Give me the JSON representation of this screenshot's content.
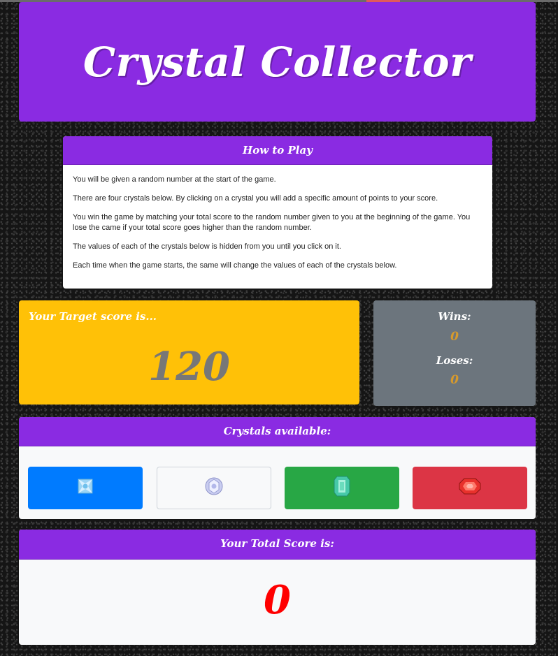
{
  "header": {
    "title": "Crystal Collector"
  },
  "how_to_play": {
    "title": "How to Play",
    "paragraphs": [
      "You will be given a random number at the start of the game.",
      "There are four crystals below. By clicking on a crystal you will add a specific amount of points to your score.",
      "You win the game by matching your total score to the random number given to you at the beginning of the game. You lose the came if your total score goes higher than the random number.",
      "The values of each of the crystals below is hidden from you until you click on it.",
      "Each time when the game starts, the same will change the values of each of the crystals below."
    ]
  },
  "target": {
    "label": "Your Target score is...",
    "value": "120"
  },
  "stats": {
    "wins_label": "Wins:",
    "wins_value": "0",
    "loses_label": "Loses:",
    "loses_value": "0"
  },
  "crystals": {
    "title": "Crystals available:",
    "items": [
      {
        "name": "blue-crystal-icon",
        "button_color": "#007bff"
      },
      {
        "name": "white-crystal-icon",
        "button_color": "#f8f9fa"
      },
      {
        "name": "green-crystal-icon",
        "button_color": "#28a745"
      },
      {
        "name": "red-crystal-icon",
        "button_color": "#dc3545"
      }
    ]
  },
  "total": {
    "label": "Your Total Score is:",
    "value": "0"
  },
  "colors": {
    "brand_purple": "#8a2be2",
    "target_yellow": "#ffc107",
    "stats_gray": "#6c757d",
    "score_red": "#ff0000",
    "counter_gold": "#d79a2c"
  }
}
